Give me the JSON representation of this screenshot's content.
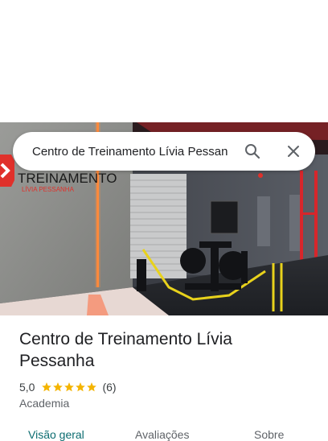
{
  "search": {
    "value": "Centro de Treinamento Lívia Pessan"
  },
  "photo": {
    "sign_main": "TREINAMENTO",
    "sign_sub": "LÍVIA PESSANHA"
  },
  "place": {
    "name": "Centro de Treinamento Lívia Pessanha",
    "rating": "5,0",
    "stars": 5,
    "review_count": "(6)",
    "category": "Academia"
  },
  "tabs": [
    {
      "label": "Visão geral",
      "active": true
    },
    {
      "label": "Avaliações",
      "active": false
    },
    {
      "label": "Sobre",
      "active": false
    }
  ],
  "colors": {
    "star": "#f4b400",
    "active_tab": "#0b6c70",
    "accent_red": "#e0312b"
  }
}
